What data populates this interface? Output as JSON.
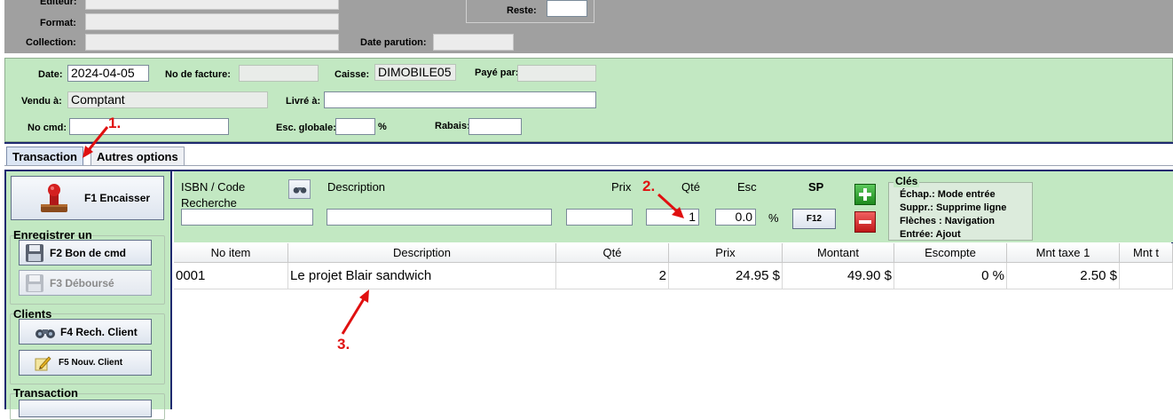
{
  "top_panel": {
    "editeur_label": "Éditeur:",
    "format_label": "Format:",
    "collection_label": "Collection:",
    "reste_label": "Reste:",
    "date_parution_label": "Date parution:"
  },
  "invoice": {
    "date_label": "Date:",
    "date_value": "2024-04-05",
    "no_facture_label": "No de facture:",
    "no_facture_value": "",
    "caisse_label": "Caisse:",
    "caisse_value": "DIMOBILE05",
    "paye_par_label": "Payé par:",
    "paye_par_value": "",
    "vendu_label": "Vendu à:",
    "vendu_value": "Comptant",
    "livre_label": "Livré à:",
    "livre_value": "",
    "no_cmd_label": "No cmd:",
    "no_cmd_value": "",
    "esc_globale_label": "Esc. globale:",
    "esc_globale_value": "",
    "percent": "%",
    "rabais_label": "Rabais:",
    "rabais_value": ""
  },
  "tabs": [
    {
      "label": "Transaction",
      "active": true
    },
    {
      "label": "Autres options",
      "active": false
    }
  ],
  "left_panel": {
    "encaisser_label": "F1 Encaisser",
    "enregistrer_title": "Enregistrer un",
    "bon_cmd_label": "F2  Bon de cmd",
    "debourse_label": "F3    Déboursé",
    "clients_title": "Clients",
    "rech_client_label": "F4  Rech. Client",
    "nouv_client_label": "F5   Nouv. Client",
    "transaction_title": "Transaction"
  },
  "entry": {
    "isbn_label": "ISBN / Code",
    "recherche_label": "Recherche",
    "description_label": "Description",
    "prix_label": "Prix",
    "qte_label": "Qté",
    "esc_label": "Esc",
    "sp_label": "SP",
    "isbn_value": "",
    "description_value": "",
    "prix_value": "",
    "qte_value": "1",
    "esc_value": "0.0",
    "percent": "%",
    "f12_label": "F12"
  },
  "keys": {
    "title": "Clés",
    "lines": [
      "Échap.: Mode entrée",
      "Suppr.: Supprime ligne",
      "Flèches : Navigation",
      "Entrée: Ajout"
    ]
  },
  "table": {
    "columns": [
      "No item",
      "Description",
      "Qté",
      "Prix",
      "Montant",
      "Escompte",
      "Mnt taxe 1",
      "Mnt t"
    ],
    "rows": [
      {
        "no_item": "0001",
        "description": "Le projet Blair sandwich",
        "qte": "2",
        "prix": "24.95 $",
        "montant": "49.90 $",
        "escompte": "0 %",
        "taxe1": "2.50 $",
        "taxe2": ""
      }
    ]
  },
  "annotations": [
    "1.",
    "2.",
    "3."
  ],
  "colors": {
    "panel_green": "#c2e8c2",
    "header_gray": "#a0a0a0",
    "frame_blue": "#1f2a70",
    "annotation_red": "#e01010"
  }
}
